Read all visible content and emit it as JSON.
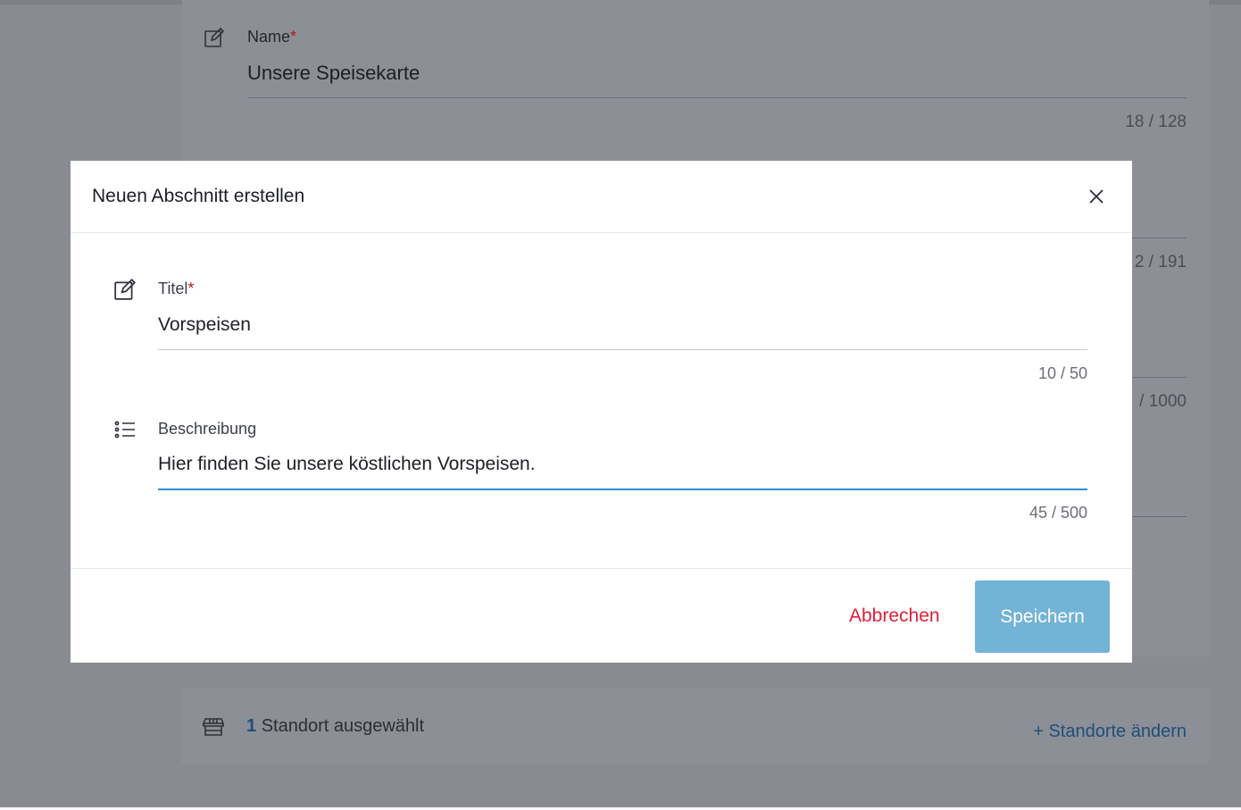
{
  "background": {
    "name_field": {
      "label": "Name",
      "required_mark": "*",
      "value": "Unsere Speisekarte",
      "counter": "18 / 128"
    },
    "hidden_counters": [
      "2 / 191",
      "/ 1000"
    ],
    "location": {
      "count": "1",
      "text": "Standort ausgewählt",
      "change_link": "+ Standorte ändern"
    }
  },
  "modal": {
    "title": "Neuen Abschnitt erstellen",
    "fields": [
      {
        "label": "Titel",
        "required_mark": "*",
        "value": "Vorspeisen",
        "counter": "10 / 50",
        "icon": "edit-icon"
      },
      {
        "label": "Beschreibung",
        "value": "Hier finden Sie unsere köstlichen Vorspeisen.",
        "counter": "45 / 500",
        "icon": "list-icon"
      }
    ],
    "cancel_label": "Abbrechen",
    "save_label": "Speichern"
  },
  "colors": {
    "accent": "#2f8fd3",
    "danger": "#de1f37",
    "save_button": "#73b3d6",
    "overlay": "#888b92"
  }
}
